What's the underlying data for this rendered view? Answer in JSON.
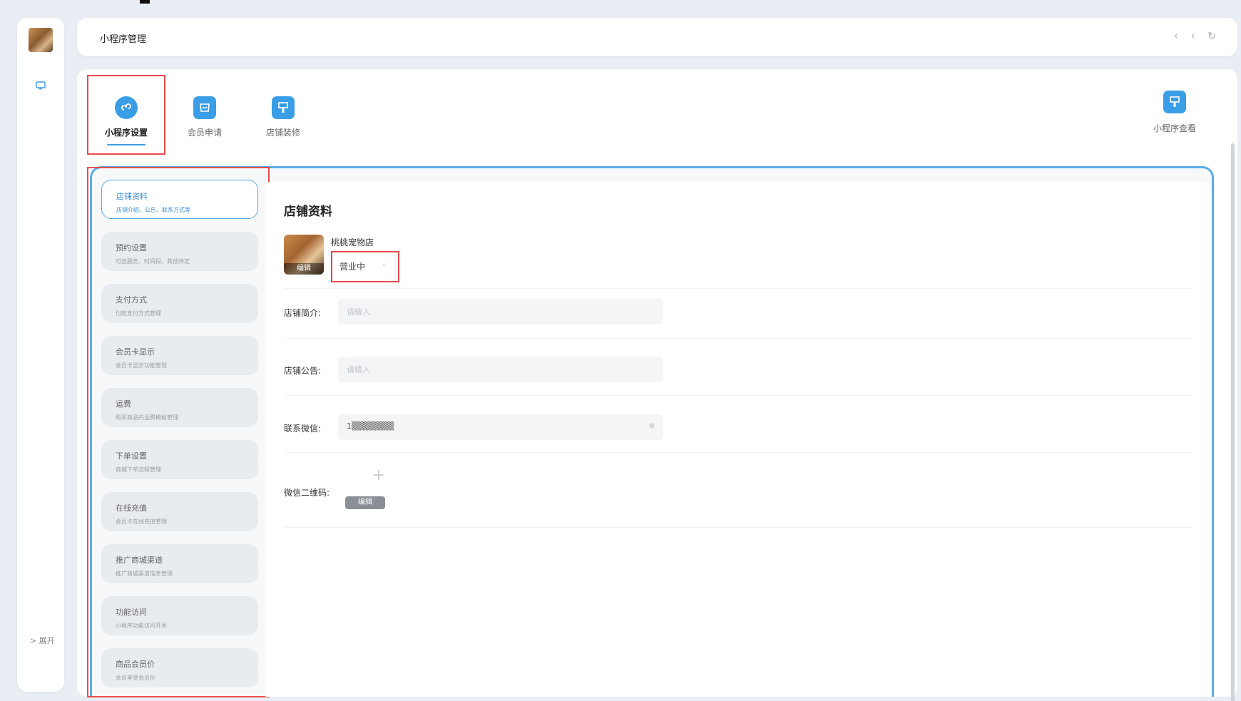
{
  "header": {
    "title": "小程序管理",
    "back": "‹",
    "forward": "›",
    "refresh": "↻"
  },
  "rail": {
    "expand_label": "> 展开"
  },
  "tabs": [
    {
      "label": "小程序设置",
      "icon": "mini-program-icon"
    },
    {
      "label": "会员申请",
      "icon": "member-apply-icon"
    },
    {
      "label": "店铺装修",
      "icon": "shop-decor-icon"
    }
  ],
  "view_tab": {
    "label": "小程序查看",
    "icon": "mini-program-view-icon"
  },
  "menu": [
    {
      "title": "店铺资料",
      "sub": "店铺介绍、公告、联系方式等"
    },
    {
      "title": "预约设置",
      "sub": "可选服务、时间段、其他待定"
    },
    {
      "title": "支付方式",
      "sub": "付款支付方式管理"
    },
    {
      "title": "会员卡显示",
      "sub": "会员卡显示功能管理"
    },
    {
      "title": "运费",
      "sub": "购买商品的运费模板管理"
    },
    {
      "title": "下单设置",
      "sub": "商城下单流程管理"
    },
    {
      "title": "在线充值",
      "sub": "会员卡在线充值管理"
    },
    {
      "title": "推广商城渠道",
      "sub": "推广商城渠道信息管理"
    },
    {
      "title": "功能访问",
      "sub": "小程序功能访问开关"
    },
    {
      "title": "商品会员价",
      "sub": "会员享受会员价"
    }
  ],
  "form": {
    "heading": "店铺资料",
    "avatar_edit": "编辑",
    "shop_name": "桃桃宠物店",
    "status": "营业中",
    "status_chevron": "⌄",
    "fields": [
      {
        "label": "店铺简介:",
        "placeholder": "请输入",
        "value": ""
      },
      {
        "label": "店铺公告:",
        "placeholder": "请输入",
        "value": ""
      },
      {
        "label": "联系微信:",
        "placeholder": "",
        "value": "1▒▒▒▒▒▒▒"
      }
    ],
    "clear_icon": "⊗",
    "qr_label": "微信二维码:",
    "qr_plus": "+",
    "qr_edit": "编辑"
  }
}
